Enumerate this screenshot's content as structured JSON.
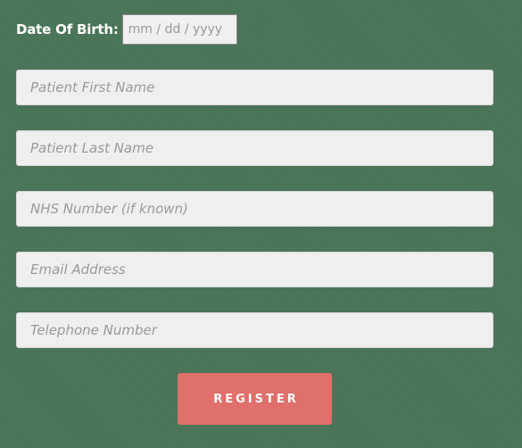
{
  "form": {
    "dob": {
      "label": "Date Of Birth:",
      "placeholder": "mm / dd / yyyy"
    },
    "fields": [
      {
        "placeholder": "Patient First Name"
      },
      {
        "placeholder": "Patient Last Name"
      },
      {
        "placeholder": "NHS Number (if known)"
      },
      {
        "placeholder": "Email Address"
      },
      {
        "placeholder": "Telephone Number"
      }
    ],
    "submit_label": "REGISTER"
  },
  "colors": {
    "background": "#4a7457",
    "field_background": "#efefef",
    "button": "#e0706c"
  }
}
